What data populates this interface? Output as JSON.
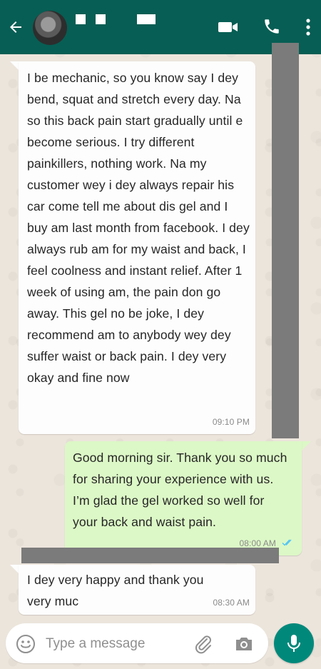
{
  "colors": {
    "header": "#075e54",
    "incoming_bubble": "#fdfdfd",
    "outgoing_bubble": "#dcf8c6",
    "mic_button": "#00897b",
    "read_ticks": "#4fc3f7",
    "redaction": "#7b7b7b"
  },
  "header": {
    "back_icon": "arrow-left-icon",
    "video_icon": "video-camera-icon",
    "call_icon": "phone-icon",
    "menu_icon": "more-vertical-icon"
  },
  "messages": [
    {
      "direction": "incoming",
      "text": "I be mechanic, so you know say I dey bend, squat and stretch every day. Na so this back pain start gradually until e become serious. I try different painkillers, nothing work. Na my customer wey i dey always repair his car come tell me about dis gel and I buy am last month from facebook. I dey always rub am for my waist and back, I feel coolness and instant relief. After 1 week of using am, the pain don go away. This gel no be joke, I dey recommend am to anybody wey dey suffer waist or back pain. I dey very okay and fine now",
      "time": "09:10 PM"
    },
    {
      "direction": "outgoing",
      "text": "Good morning sir. Thank you so much for sharing your experience with us. I’m glad the gel worked so well for your back and waist pain.",
      "time": "08:00 AM",
      "status_icon": "double-check-icon"
    },
    {
      "direction": "incoming",
      "text": "I dey very happy and thank you very muc",
      "time": "08:30 AM"
    }
  ],
  "composer": {
    "placeholder": "Type a message",
    "emoji_icon": "emoji-icon",
    "attach_icon": "paperclip-icon",
    "camera_icon": "camera-icon",
    "mic_icon": "microphone-icon"
  }
}
